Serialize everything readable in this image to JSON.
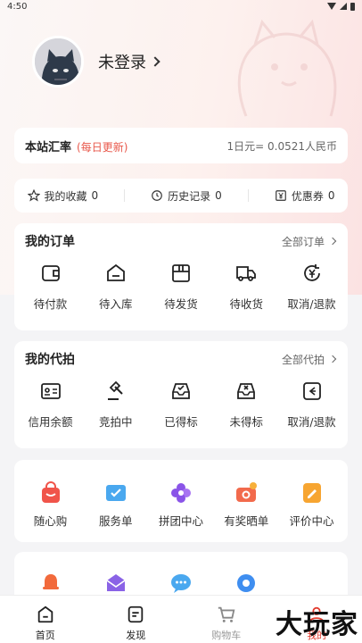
{
  "status_bar": {
    "time": "4:50"
  },
  "profile": {
    "login_label": "未登录"
  },
  "rate": {
    "label": "本站汇率",
    "hint": "(每日更新)",
    "value": "1日元= 0.0521人民币"
  },
  "stats": [
    {
      "icon": "star-icon",
      "label": "我的收藏",
      "count": "0"
    },
    {
      "icon": "clock-icon",
      "label": "历史记录",
      "count": "0"
    },
    {
      "icon": "yen-ticket-icon",
      "label": "优惠券",
      "count": "0"
    }
  ],
  "orders": {
    "title": "我的订单",
    "link": "全部订单",
    "items": [
      {
        "icon": "wallet-icon",
        "label": "待付款"
      },
      {
        "icon": "warehouse-icon",
        "label": "待入库"
      },
      {
        "icon": "box-icon",
        "label": "待发货"
      },
      {
        "icon": "truck-icon",
        "label": "待收货"
      },
      {
        "icon": "yen-refund-icon",
        "label": "取消/退款"
      }
    ]
  },
  "bids": {
    "title": "我的代拍",
    "link": "全部代拍",
    "items": [
      {
        "icon": "id-card-icon",
        "label": "信用余额"
      },
      {
        "icon": "gavel-icon",
        "label": "竞拍中"
      },
      {
        "icon": "inbox-check-icon",
        "label": "已得标"
      },
      {
        "icon": "inbox-x-icon",
        "label": "未得标"
      },
      {
        "icon": "refund-icon",
        "label": "取消/退款"
      }
    ]
  },
  "services": [
    {
      "icon": "shopping-bag-icon",
      "label": "随心购",
      "color": "#f0544a"
    },
    {
      "icon": "checklist-icon",
      "label": "服务单",
      "color": "#4aa8ef"
    },
    {
      "icon": "group-flower-icon",
      "label": "拼团中心",
      "color": "#8a54e8"
    },
    {
      "icon": "camera-reward-icon",
      "label": "有奖晒单",
      "color": "#f26a4c"
    },
    {
      "icon": "edit-review-icon",
      "label": "评价中心",
      "color": "#f7a531"
    }
  ],
  "more": [
    {
      "icon": "bell-icon",
      "color": "#f26a3c"
    },
    {
      "icon": "mail-icon",
      "color": "#8a63e6"
    },
    {
      "icon": "chat-icon",
      "color": "#4aa8ef"
    },
    {
      "icon": "settings-icon",
      "color": "#3f8ef0"
    }
  ],
  "tabbar": [
    {
      "icon": "home-icon",
      "label": "首页"
    },
    {
      "icon": "discover-icon",
      "label": "发现"
    },
    {
      "icon": "cart-icon",
      "label": "购物车"
    },
    {
      "icon": "user-icon",
      "label": "我的"
    }
  ],
  "watermark": "大玩家"
}
